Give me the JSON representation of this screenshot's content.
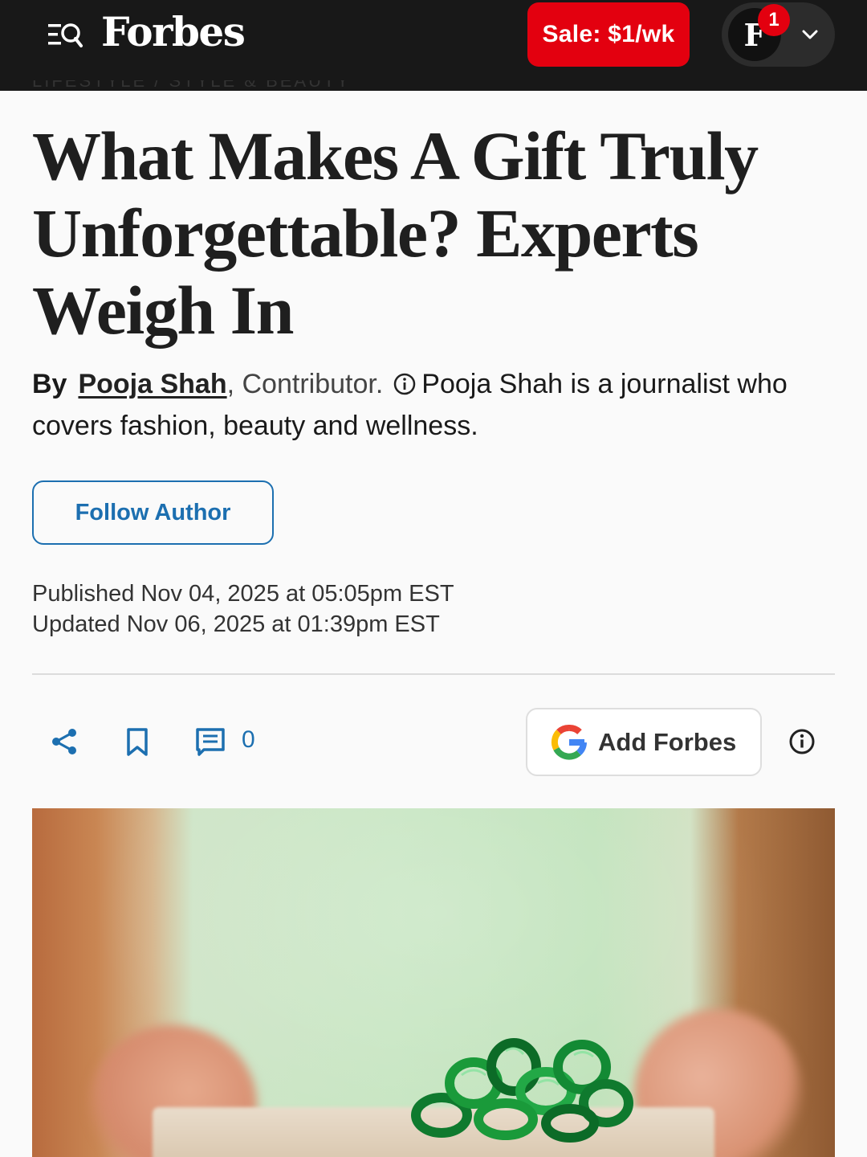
{
  "header": {
    "logo_text": "Forbes",
    "sale_label": "Sale: $1/wk",
    "account_initial": "F",
    "notification_count": "1"
  },
  "article": {
    "breadcrumb": "LIFESTYLE  /  STYLE & BEAUTY",
    "headline": "What Makes A Gift Truly Unforgettable? Experts Weigh In",
    "byline_prefix": "By",
    "author_name": "Pooja Shah",
    "author_role": ", Contributor.",
    "author_bio": "Pooja Shah is a journalist who covers fashion, beauty and wellness.",
    "follow_label": "Follow Author",
    "published": "Published Nov 04, 2025 at 05:05pm EST",
    "updated": "Updated Nov 06, 2025 at 01:39pm EST"
  },
  "actions": {
    "comment_count": "0",
    "add_forbes_label": "Add Forbes"
  },
  "icons": [
    "menu-search-icon",
    "chevron-down-icon",
    "info-icon",
    "share-icon",
    "bookmark-icon",
    "comment-icon",
    "google-icon"
  ],
  "colors": {
    "topbar_bg": "#181818",
    "sale_red": "#e3000f",
    "accent_blue": "#1c6fb0"
  }
}
